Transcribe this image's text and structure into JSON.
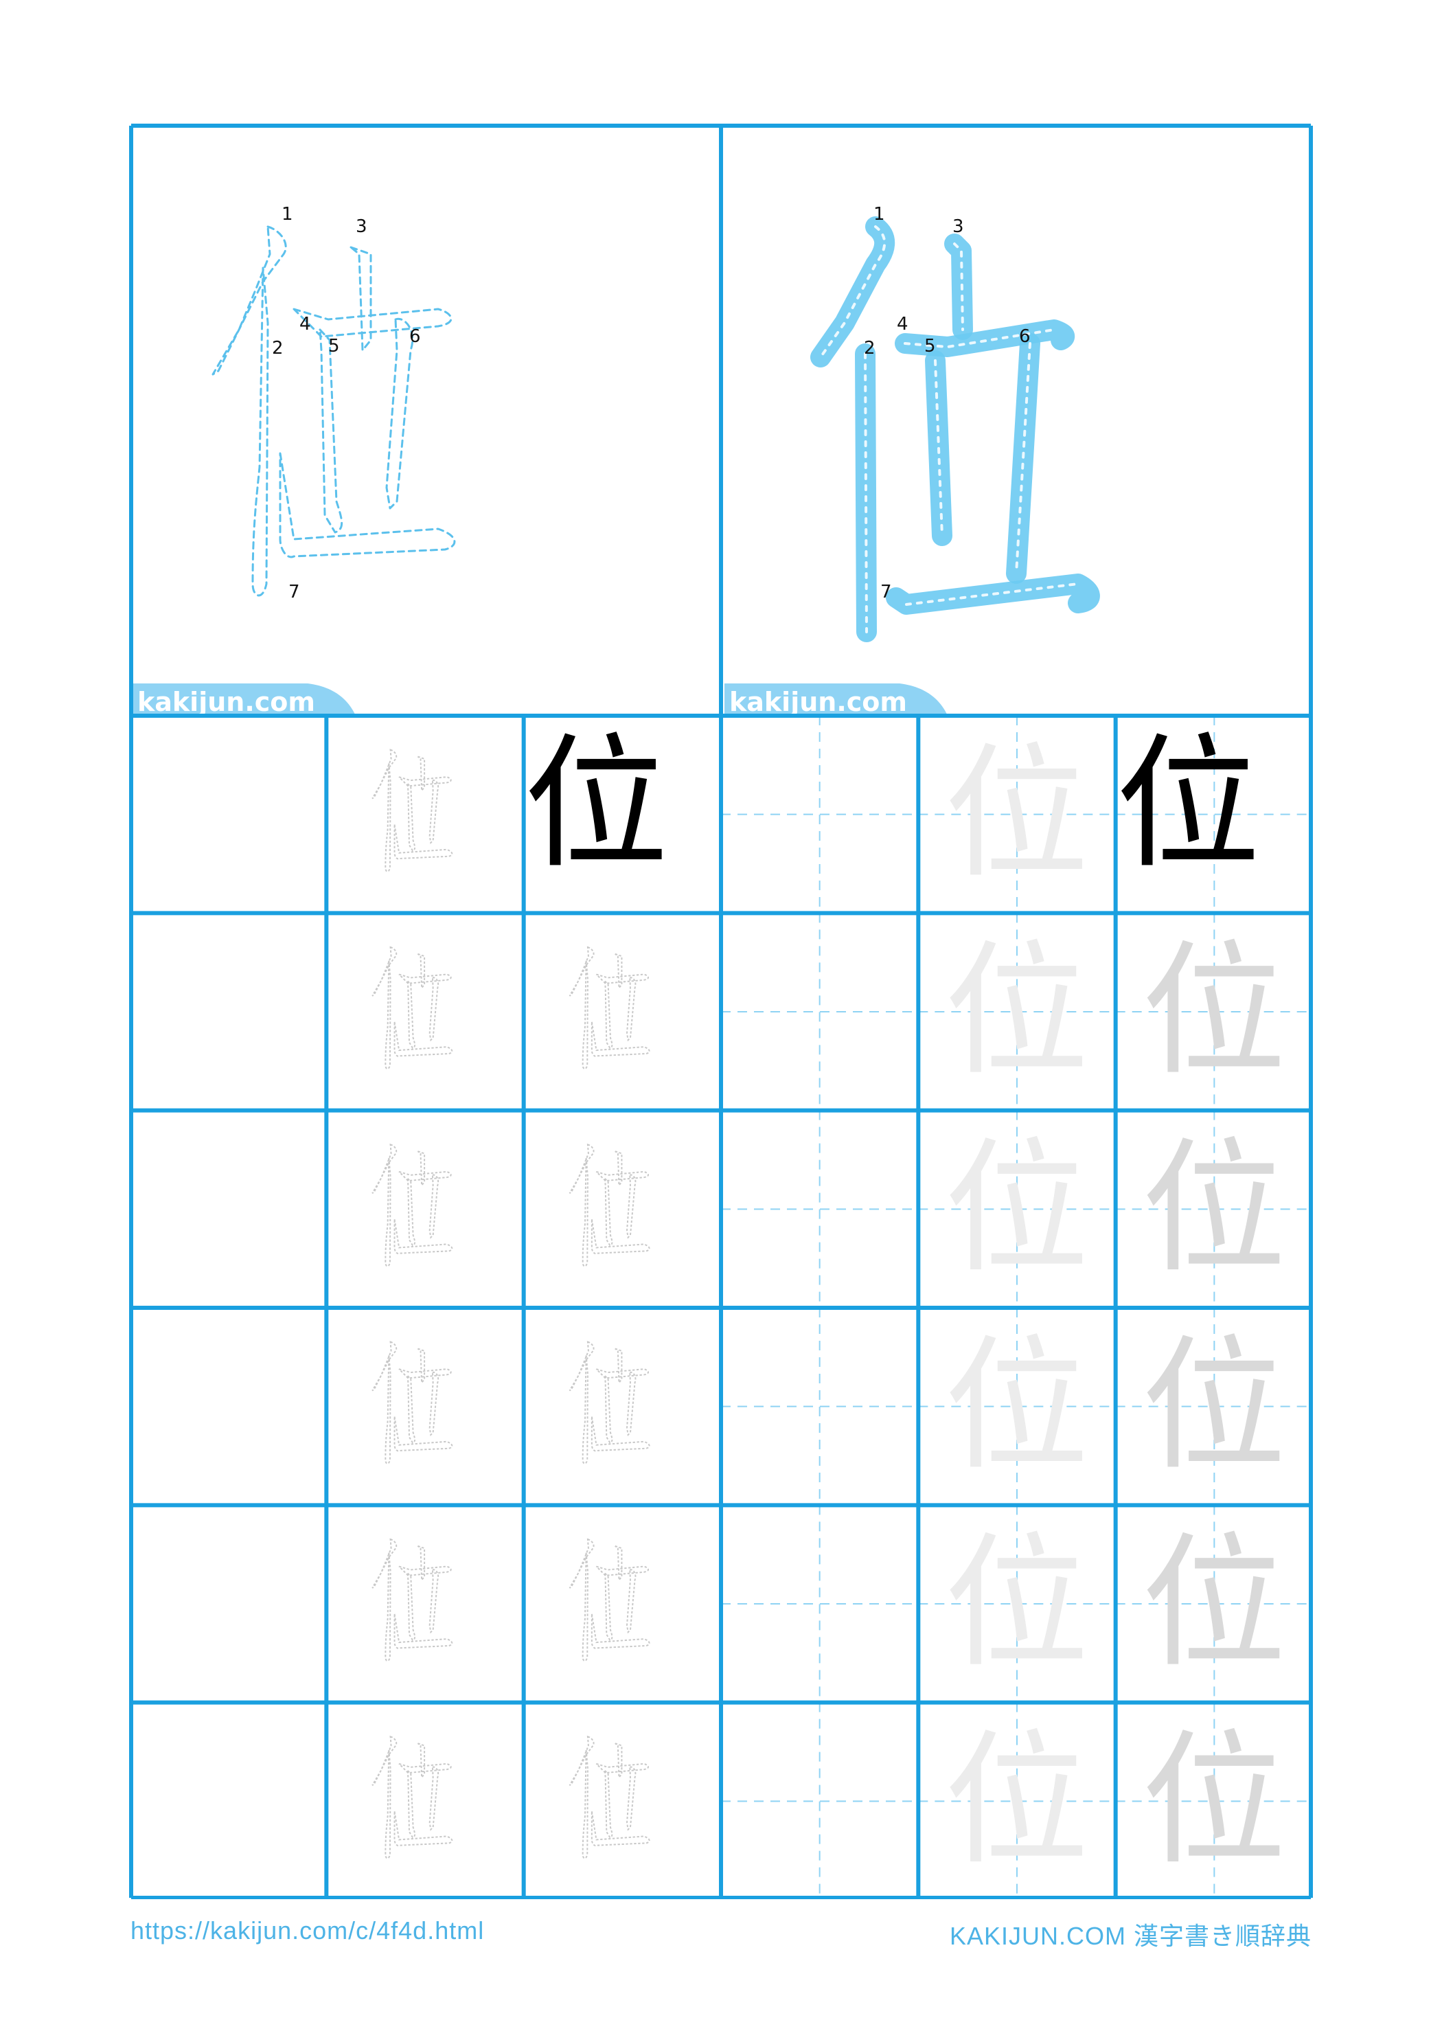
{
  "worksheet": {
    "kanji": "位",
    "stroke_numbers": [
      "1",
      "2",
      "3",
      "4",
      "5",
      "6",
      "7"
    ],
    "watermark": "kakijun.com",
    "footer_url": "https://kakijun.com/c/4f4d.html",
    "footer_brand": "KAKIJUN.COM 漢字書き順辞典"
  },
  "colors": {
    "grid": "#1aa0e0",
    "trace": "#5bc0ec",
    "solid": "#6ccaf2",
    "guide": "#8fd3f4",
    "footer": "#4db3e6"
  }
}
